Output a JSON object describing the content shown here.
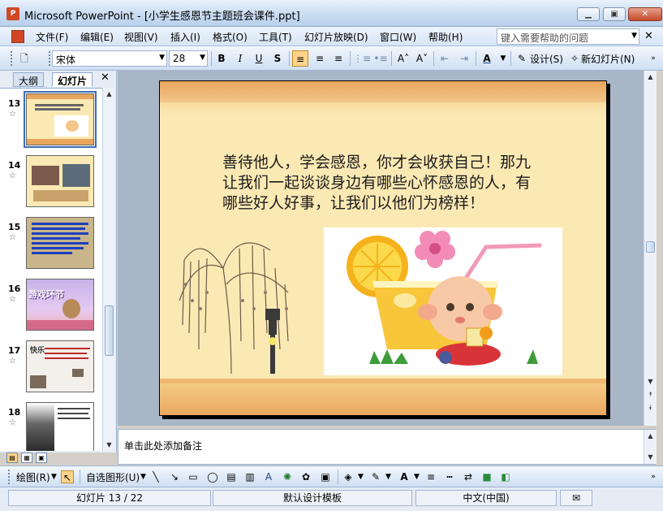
{
  "window": {
    "title": "Microsoft PowerPoint - [小学生感恩节主题班会课件.ppt]",
    "app_icon": "P"
  },
  "menubar": {
    "items": [
      "文件(F)",
      "编辑(E)",
      "视图(V)",
      "插入(I)",
      "格式(O)",
      "工具(T)",
      "幻灯片放映(D)",
      "窗口(W)",
      "帮助(H)"
    ],
    "help_placeholder": "键入需要帮助的问题"
  },
  "toolbar": {
    "font_name": "宋体",
    "font_size": "28",
    "bold": "B",
    "italic": "I",
    "underline": "U",
    "shadow": "S",
    "design_label": "设计(S)",
    "new_slide_label": "新幻灯片(N)"
  },
  "leftpane": {
    "tabs": [
      "大纲",
      "幻灯片"
    ],
    "selected_tab": "幻灯片",
    "thumbnails": [
      {
        "num": "13",
        "selected": true
      },
      {
        "num": "14",
        "selected": false
      },
      {
        "num": "15",
        "selected": false
      },
      {
        "num": "16",
        "selected": false,
        "caption": "游戏环节"
      },
      {
        "num": "17",
        "selected": false,
        "caption": "快乐"
      },
      {
        "num": "18",
        "selected": false
      }
    ]
  },
  "slide": {
    "body_text": "善待他人，学会感恩，你才会收获自己！那九让我们一起谈谈身边有哪些心怀感恩的人，有哪些好人好事，让我们以他们为榜样！"
  },
  "notes": {
    "placeholder": "单击此处添加备注"
  },
  "drawbar": {
    "draw_label": "绘图(R)",
    "autoshapes_label": "自选图形(U)"
  },
  "statusbar": {
    "slide_info": "幻灯片 13 / 22",
    "template": "默认设计模板",
    "language": "中文(中国)"
  }
}
